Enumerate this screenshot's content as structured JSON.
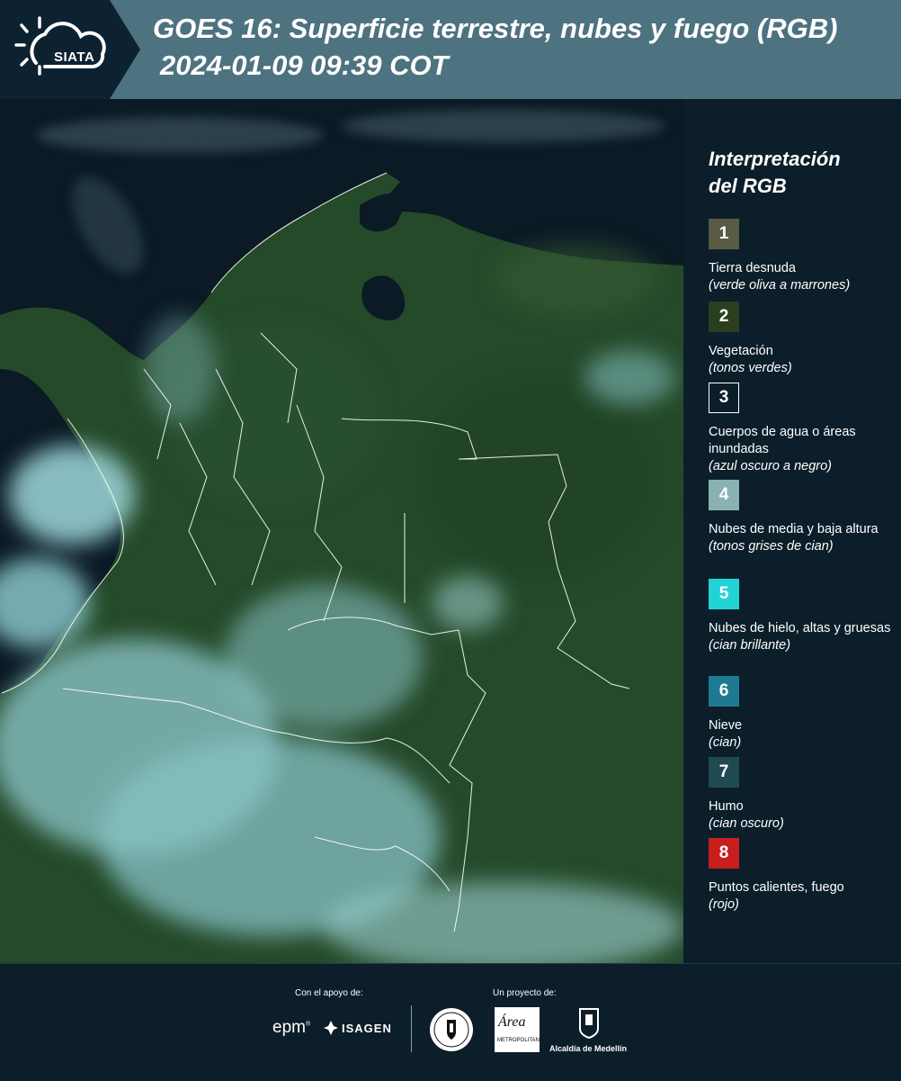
{
  "header": {
    "logo_text": "SIATA",
    "title": "GOES 16: Superficie terrestre, nubes y fuego (RGB)",
    "datetime": "2024-01-09 09:39 COT"
  },
  "legend": {
    "title_line1": "Interpretación",
    "title_line2": "del RGB",
    "items": [
      {
        "number": "1",
        "label": "Tierra desnuda",
        "note": "(verde oliva a marrones)",
        "color": "#595b45"
      },
      {
        "number": "2",
        "label": "Vegetación",
        "note": "(tonos verdes)",
        "color": "#2b3f1f"
      },
      {
        "number": "3",
        "label": "Cuerpos de agua o áreas inundadas",
        "note": "(azul oscuro a negro)",
        "color": "#0c1e2a"
      },
      {
        "number": "4",
        "label": "Nubes de media y baja altura",
        "note": "(tonos grises de cian)",
        "color": "#8ab2b3"
      },
      {
        "number": "5",
        "label": "Nubes de hielo, altas y gruesas",
        "note": "(cian brillante)",
        "color": "#22d3d6"
      },
      {
        "number": "6",
        "label": "Nieve",
        "note": "(cian)",
        "color": "#1d7a92"
      },
      {
        "number": "7",
        "label": "Humo",
        "note": "(cian oscuro)",
        "color": "#1f4a52"
      },
      {
        "number": "8",
        "label": "Puntos calientes, fuego",
        "note": "(rojo)",
        "color": "#c81e1e"
      }
    ]
  },
  "footer": {
    "support_label": "Con el apoyo de:",
    "project_label": "Un proyecto de:",
    "epm": "epm",
    "isagen": "ISAGEN",
    "area_script": "Área",
    "area_sub": "METROPOLITANA",
    "alcaldia": "Alcaldía de Medellín"
  },
  "map": {
    "ocean_color": "#0b1a24",
    "land_color": "#254a2a",
    "cloud_color": "#8fd4d8",
    "border_color": "#ffffff"
  }
}
